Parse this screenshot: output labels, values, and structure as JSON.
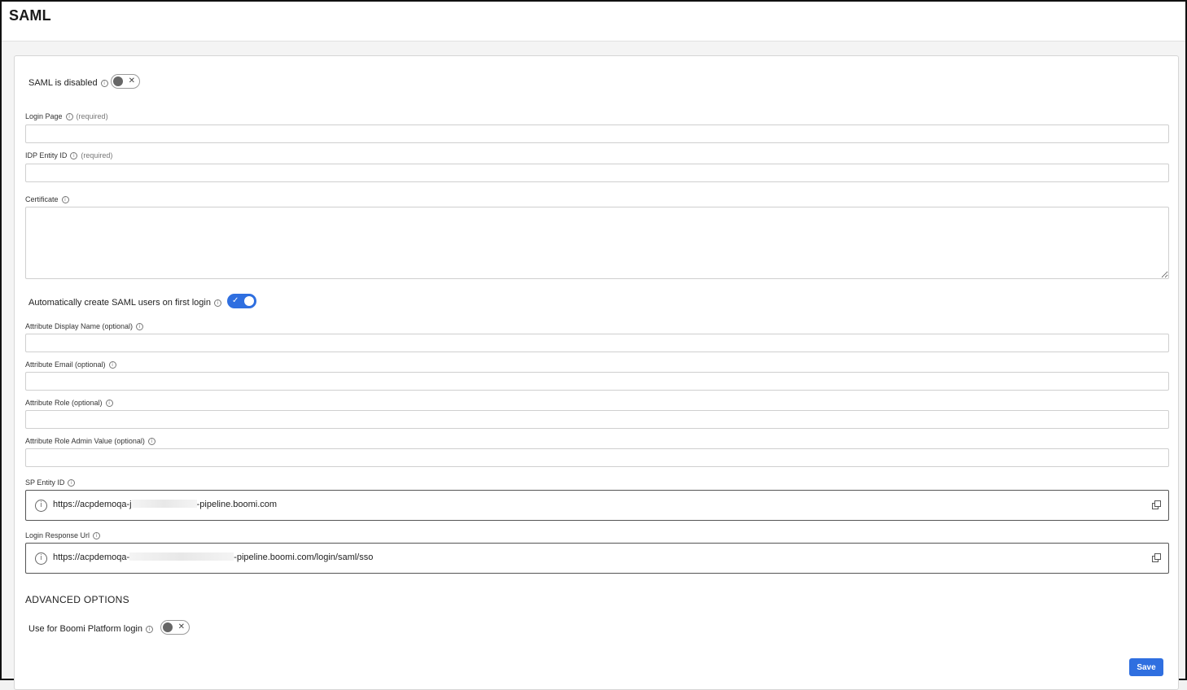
{
  "page": {
    "title": "SAML"
  },
  "saml_toggle": {
    "label": "SAML is disabled",
    "enabled": false,
    "off_mark": "✕"
  },
  "fields": {
    "login_page": {
      "label": "Login Page",
      "note": "(required)",
      "value": ""
    },
    "idp_entity_id": {
      "label": "IDP Entity ID",
      "note": "(required)",
      "value": ""
    },
    "certificate": {
      "label": "Certificate",
      "value": ""
    },
    "attr_display_name": {
      "label": "Attribute Display Name (optional)",
      "value": ""
    },
    "attr_email": {
      "label": "Attribute Email (optional)",
      "value": ""
    },
    "attr_role": {
      "label": "Attribute Role (optional)",
      "value": ""
    },
    "attr_role_admin": {
      "label": "Attribute Role Admin Value (optional)",
      "value": ""
    }
  },
  "auto_create": {
    "label": "Automatically create SAML users on first login",
    "enabled": true,
    "on_mark": "✓"
  },
  "sp_entity_id": {
    "label": "SP Entity ID",
    "value_start": "https://acpdemoqa-j",
    "value_end": "-pipeline.boomi.com"
  },
  "login_response_url": {
    "label": "Login Response Url",
    "value_start": "https://acpdemoqa-",
    "value_end": "-pipeline.boomi.com/login/saml/sso"
  },
  "advanced": {
    "title": "ADVANCED OPTIONS",
    "platform_login": {
      "label": "Use for Boomi Platform login",
      "enabled": false,
      "off_mark": "✕"
    }
  },
  "actions": {
    "save_label": "Save"
  },
  "colors": {
    "accent": "#2f6fe0",
    "border": "#cfcfcf",
    "text": "#222222"
  },
  "icons": {
    "info": "info-circle-icon",
    "copy": "copy-icon"
  }
}
